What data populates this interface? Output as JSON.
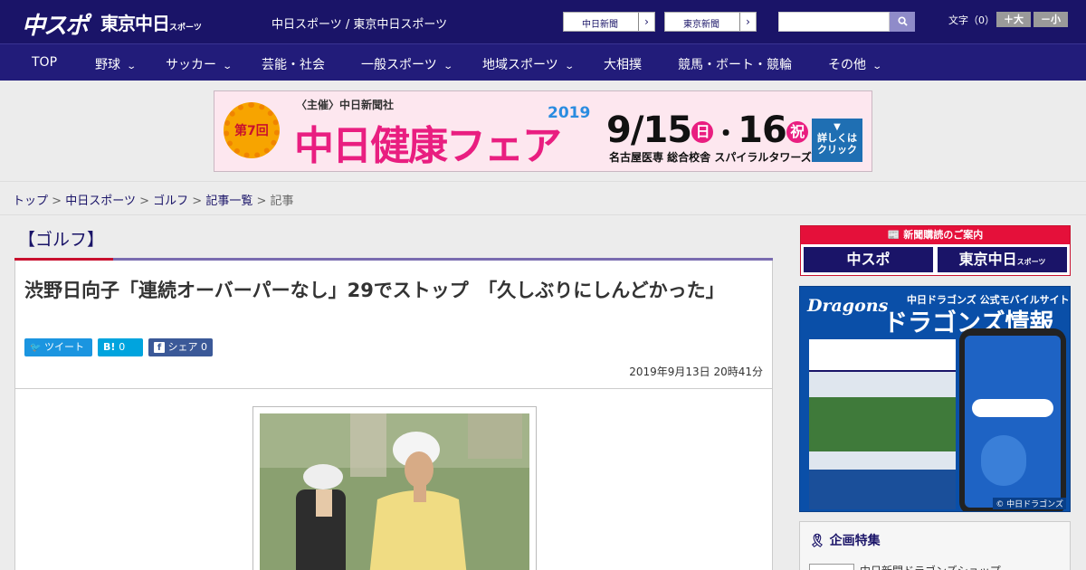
{
  "header": {
    "logo_chuspo": "中スポ",
    "logo_tokyo": "東京中日",
    "logo_tokyo_small": "スポーツ",
    "tagline": "中日スポーツ / 東京中日スポーツ",
    "site_links": [
      {
        "label": "中日新聞",
        "arrow": "›"
      },
      {
        "label": "東京新聞",
        "arrow": "›"
      }
    ],
    "search": {
      "placeholder": "",
      "button_icon": "search-icon"
    },
    "font_size": {
      "label": "文字（0）",
      "larger": "＋大",
      "smaller": "－小"
    }
  },
  "nav": {
    "items": [
      {
        "label": "TOP",
        "dropdown": false
      },
      {
        "label": "野球",
        "dropdown": true
      },
      {
        "label": "サッカー",
        "dropdown": true
      },
      {
        "label": "芸能・社会",
        "dropdown": false
      },
      {
        "label": "一般スポーツ",
        "dropdown": true
      },
      {
        "label": "地域スポーツ",
        "dropdown": true
      },
      {
        "label": "大相撲",
        "dropdown": false
      },
      {
        "label": "競馬・ボート・競輪",
        "dropdown": false
      },
      {
        "label": "その他",
        "dropdown": true
      }
    ]
  },
  "banner": {
    "edition": "第7回",
    "host": "〈主催〉中日新聞社",
    "title": "中日健康フェア",
    "year": "2019",
    "date_main": "9/15",
    "day1": "日",
    "date_sep": "・",
    "date_second": "16",
    "day2": "祝",
    "venue": "名古屋医専 総合校舎 スパイラルタワーズ",
    "cta": "詳しくはクリック"
  },
  "breadcrumb": {
    "items": [
      "トップ",
      "中日スポーツ",
      "ゴルフ",
      "記事一覧"
    ],
    "current": "記事",
    "separator": ">"
  },
  "article": {
    "category": "【ゴルフ】",
    "title": "渋野日向子「連続オーバーパーなし」29でストップ　「久しぶりにしんどかった」",
    "share": {
      "tweet_label": "ツイート",
      "hatena_label": "B!",
      "hatena_count": "0",
      "fb_label": "シェア",
      "fb_count": "0"
    },
    "datetime": "2019年9月13日 20時41分"
  },
  "sidebar": {
    "subscription": {
      "heading": "新聞購読のご案内",
      "left": "中スポ",
      "right": "東京中日",
      "right_small": "スポーツ"
    },
    "dragons": {
      "brand": "Dragons",
      "kicker": "中日ドラゴンズ 公式モバイルサイト",
      "title": "ドラゴンズ情報",
      "copyright": "© 中日ドラゴンズ"
    },
    "feature": {
      "heading": "企画特集",
      "first_item": "中日新聞ドラゴンズショップ"
    }
  },
  "colors": {
    "header_bg": "#1a1468",
    "nav_bg": "#221c7a",
    "accent_red": "#c8102e",
    "twitter": "#1b95e0",
    "hatena": "#00a4de",
    "facebook": "#3b5998"
  }
}
